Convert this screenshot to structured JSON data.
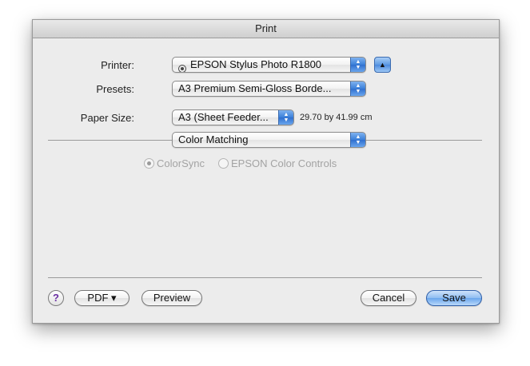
{
  "window": {
    "title": "Print"
  },
  "printer": {
    "label": "Printer:",
    "value": "EPSON Stylus Photo R1800",
    "icon": "printer-icon"
  },
  "disclosure": {
    "icon": "triangle-up-icon",
    "glyph": "▲"
  },
  "presets": {
    "label": "Presets:",
    "value": "A3 Premium Semi-Gloss Borde..."
  },
  "paper_size": {
    "label": "Paper Size:",
    "value": "A3 (Sheet Feeder...",
    "dimensions": "29.70 by 41.99 cm"
  },
  "panel_popup": {
    "value": "Color Matching"
  },
  "color_options": [
    {
      "label": "ColorSync",
      "selected": true
    },
    {
      "label": "EPSON Color Controls",
      "selected": false
    }
  ],
  "buttons": {
    "help": "?",
    "pdf": "PDF ▾",
    "preview": "Preview",
    "cancel": "Cancel",
    "save": "Save"
  },
  "colors": {
    "default_button": "#6aa6ec",
    "window_bg": "#ececec"
  }
}
